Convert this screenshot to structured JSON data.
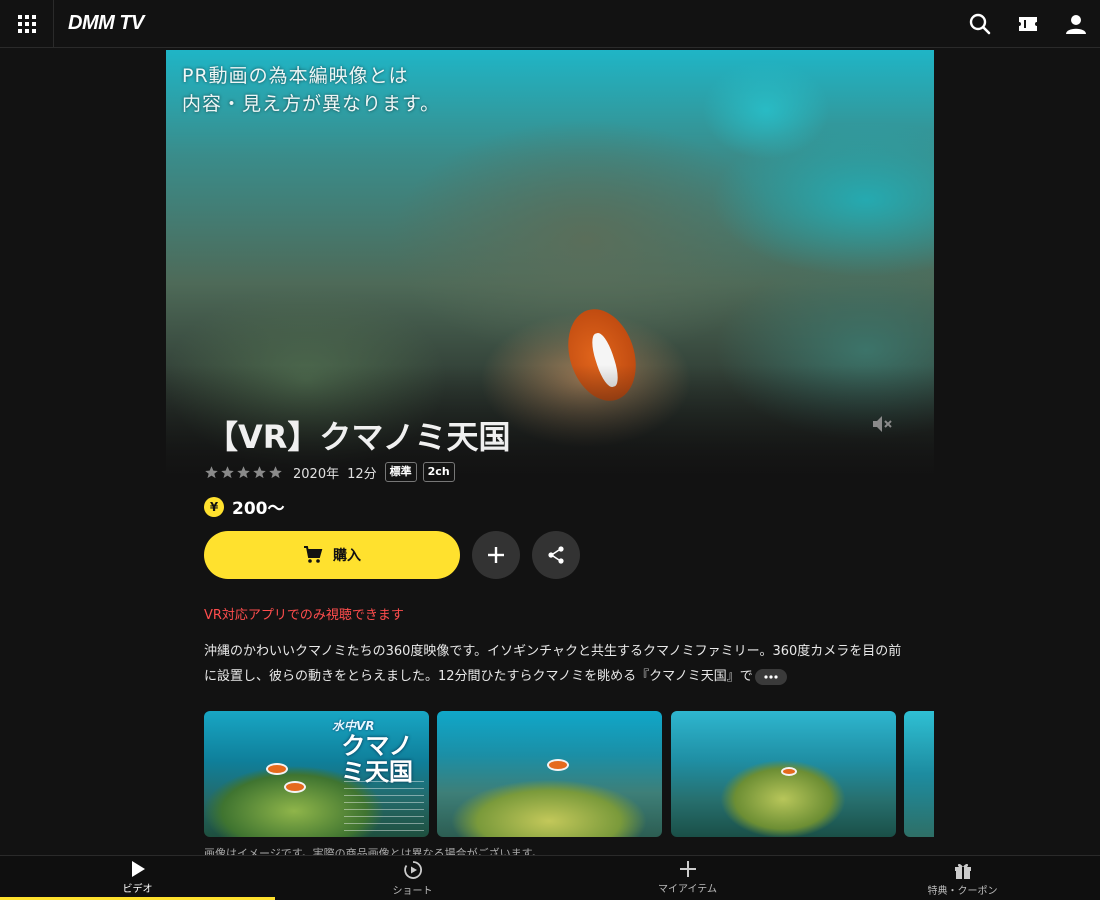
{
  "header": {
    "logo": "DMM TV",
    "icons": [
      "grid-menu-icon",
      "search-icon",
      "ticket-icon",
      "user-icon"
    ]
  },
  "hero": {
    "caption_line1": "PR動画の為本編映像とは",
    "caption_line2": "内容・見え方が異なります。",
    "title": "【VR】クマノミ天国"
  },
  "meta": {
    "rating": 0,
    "year": "2020年",
    "duration": "12分",
    "badge_quality": "標準",
    "badge_audio": "2ch"
  },
  "price": {
    "currency_symbol": "¥",
    "value": "200〜"
  },
  "actions": {
    "buy_label": "購入"
  },
  "notice": "VR対応アプリでのみ視聴できます",
  "description": "沖縄のかわいいクマノミたちの360度映像です。イソギンチャクと共生するクマノミファミリー。360度カメラを目の前に設置し、彼らの動きをとらえました。12分間ひたすらクマノミを眺める『クマノミ天国』で",
  "thumbnails": {
    "first_title_small": "水中VR",
    "first_title_big": "クマノミ天国"
  },
  "image_note": "画像はイメージです。実際の商品画像とは異なる場合がございます。",
  "bottom_nav": [
    {
      "label": "ビデオ",
      "icon": "play-icon",
      "active": true
    },
    {
      "label": "ショート",
      "icon": "short-play-icon",
      "active": false
    },
    {
      "label": "マイアイテム",
      "icon": "plus-icon",
      "active": false
    },
    {
      "label": "特典・クーポン",
      "icon": "gift-icon",
      "active": false
    }
  ],
  "colors": {
    "accent": "#ffe12e",
    "notice": "#ff4d4d",
    "background": "#121212"
  }
}
